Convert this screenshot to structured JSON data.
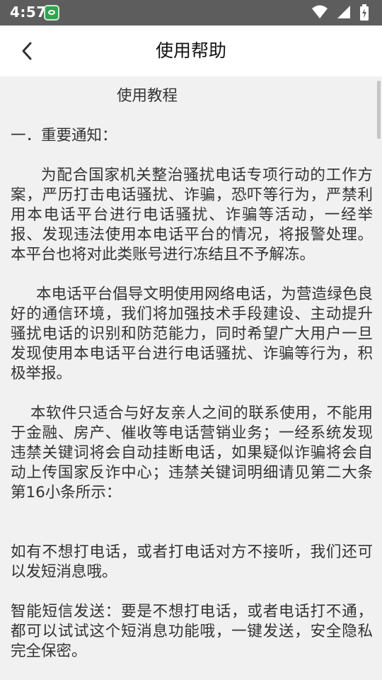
{
  "status_bar": {
    "time": "4:57",
    "icons": [
      "app-notification-icon",
      "wifi-icon",
      "cell-signal-icon",
      "battery-charging-icon"
    ]
  },
  "app_bar": {
    "back_icon": "chevron-left-icon",
    "title": "使用帮助"
  },
  "doc": {
    "title": "使用教程",
    "section_heading": "一．重要通知：",
    "paragraphs": [
      "为配合国家机关整治骚扰电话专项行动的工作方案，严历打击电话骚扰、诈骗，恐吓等行为，严禁利用本电话平台进行电话骚扰、诈骗等活动，一经举报、发现违法使用本电话平台的情况，将报警处理。本平台也将对此类账号进行冻结且不予解冻。",
      "本电话平台倡导文明使用网络电话，为营造绿色良好的通信环境，我们将加强技术手段建设、主动提升骚扰电话的识别和防范能力，同时希望广大用户一旦发现使用本电话平台进行电话骚扰、诈骗等行为，积极举报。",
      "本软件只适合与好友亲人之间的联系使用，不能用于金融、房产、催收等电话营销业务；一经系统发现违禁关键词将会自动挂断电话，如果疑似诈骗将会自动上传国家反诈中心；违禁关键词明细请见第二大条第16小条所示：",
      "如有不想打电话，或者打电话对方不接听，我们还可以发短消息哦。",
      "智能短信发送：要是不想打电话，或者电话打不通，都可以试试这个短消息功能哦，一键发送，安全隐私完全保密。"
    ]
  },
  "colors": {
    "status_bar": "#5d5d5d",
    "app_bar": "#ffffff",
    "content_bg": "#f1f1f1",
    "text": "#333333"
  }
}
